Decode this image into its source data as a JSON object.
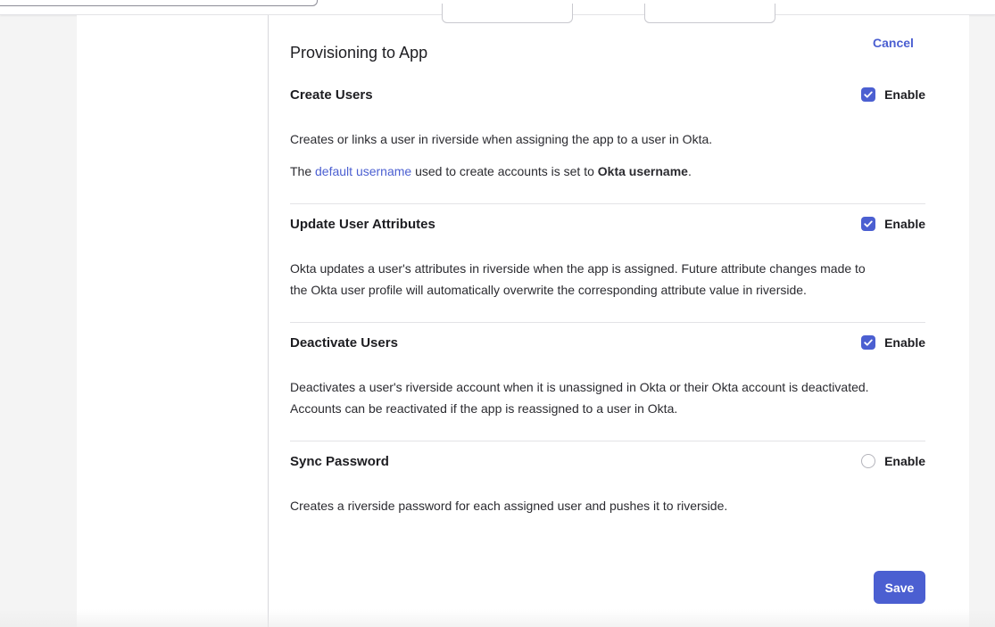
{
  "header": {
    "cancel_label": "Cancel",
    "section_title": "Provisioning to App"
  },
  "features": [
    {
      "title": "Create Users",
      "enabled": true,
      "enable_label": "Enable",
      "desc_line1": "Creates or links a user in riverside when assigning the app to a user in Okta.",
      "desc_line2_prefix": "The ",
      "desc_line2_link": "default username",
      "desc_line2_mid": " used to create accounts is set to ",
      "desc_line2_bold": "Okta username",
      "desc_line2_suffix": "."
    },
    {
      "title": "Update User Attributes",
      "enabled": true,
      "enable_label": "Enable",
      "desc_line1": "Okta updates a user's attributes in riverside when the app is assigned. Future attribute changes made to",
      "desc_line2": "the Okta user profile will automatically overwrite the corresponding attribute value in riverside."
    },
    {
      "title": "Deactivate Users",
      "enabled": true,
      "enable_label": "Enable",
      "desc_line1": "Deactivates a user's riverside account when it is unassigned in Okta or their Okta account is deactivated.",
      "desc_line2": "Accounts can be reactivated if the app is reassigned to a user in Okta."
    },
    {
      "title": "Sync Password",
      "enabled": false,
      "enable_label": "Enable",
      "desc_line1": "Creates a riverside password for each assigned user and pushes it to riverside."
    }
  ],
  "footer": {
    "save_label": "Save"
  },
  "colors": {
    "accent": "#4b5fd1",
    "text": "#1d1d21",
    "divider": "#e3e3e6"
  }
}
